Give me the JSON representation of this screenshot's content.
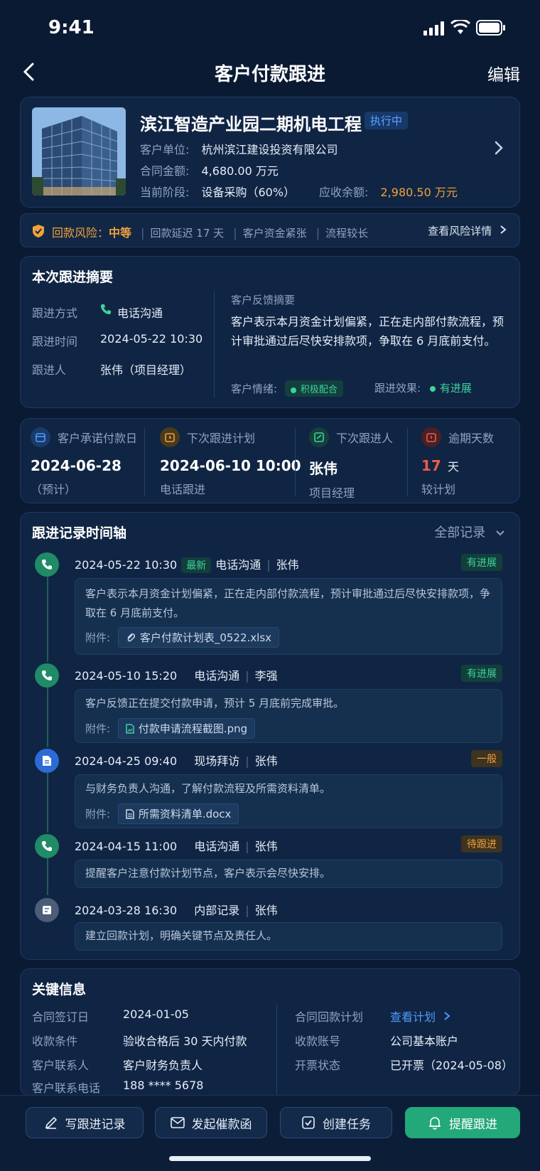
{
  "status_bar": {
    "time": "9:41"
  },
  "nav": {
    "title": "客户付款跟进",
    "edit": "编辑"
  },
  "project": {
    "name": "滨江智造产业园二期机电工程",
    "status": "执行中",
    "client_label": "客户单位:",
    "client": "杭州滨江建设投资有限公司",
    "amount_label": "合同金额:",
    "amount": "4,680.00 万元",
    "stage_label": "当前阶段:",
    "stage": "设备采购（60%）",
    "receivable_label": "应收余额:",
    "receivable": "2,980.50 万元"
  },
  "risk": {
    "label": "回款风险：",
    "level": "中等",
    "items": [
      "回款延迟 17 天",
      "客户资金紧张",
      "流程较长"
    ],
    "detail_link": "查看风险详情"
  },
  "summary": {
    "title": "本次跟进摘要",
    "method_label": "跟进方式",
    "method": "电话沟通",
    "time_label": "跟进时间",
    "time": "2024-05-22 10:30",
    "person_label": "跟进人",
    "person": "张伟（项目经理）",
    "feedback_label": "客户反馈摘要",
    "feedback": "客户表示本月资金计划偏紧，正在走内部付款流程，预计审批通过后尽快安排款项，争取在 6 月底前支付。",
    "mood_label": "客户情绪:",
    "mood": "积极配合",
    "effect_label": "跟进效果:",
    "effect": "有进展"
  },
  "stats": [
    {
      "label": "客户承诺付款日",
      "value": "2024-06-28",
      "sub": "（预计）",
      "icon": "calendar-icon",
      "color": "#4e9bff"
    },
    {
      "label": "下次跟进计划",
      "value": "2024-06-10 10:00",
      "sub": "电话跟进",
      "icon": "clock-icon",
      "color": "#f0a13a"
    },
    {
      "label": "下次跟进人",
      "value": "张伟",
      "sub": "项目经理",
      "icon": "person-icon",
      "color": "#3fd39a"
    },
    {
      "label": "逾期天数",
      "value": "17",
      "unit": "天",
      "sub": "较计划",
      "icon": "alarm-icon",
      "color": "#f05a4a"
    }
  ],
  "timeline": {
    "title": "跟进记录时间轴",
    "filter": "全部记录",
    "attach_label": "附件:",
    "records": [
      {
        "datetime": "2024-05-22 10:30",
        "latest": "最新",
        "type": "电话沟通",
        "person": "张伟",
        "status": "有进展",
        "text": "客户表示本月资金计划偏紧，正在走内部付款流程，预计审批通过后尽快安排款项，争取在 6 月底前支付。",
        "attachment": "客户付款计划表_0522.xlsx"
      },
      {
        "datetime": "2024-05-10 15:20",
        "type": "电话沟通",
        "person": "李强",
        "status": "有进展",
        "text": "客户反馈正在提交付款申请，预计 5 月底前完成审批。",
        "attachment": "付款申请流程截图.png"
      },
      {
        "datetime": "2024-04-25 09:40",
        "type": "现场拜访",
        "person": "张伟",
        "status": "一般",
        "text": "与财务负责人沟通，了解付款流程及所需资料清单。",
        "attachment": "所需资料清单.docx"
      },
      {
        "datetime": "2024-04-15 11:00",
        "type": "电话沟通",
        "person": "张伟",
        "status": "待跟进",
        "text": "提醒客户注意付款计划节点，客户表示会尽快安排。"
      },
      {
        "datetime": "2024-03-28 16:30",
        "type": "内部记录",
        "person": "张伟",
        "text": "建立回款计划，明确关键节点及责任人。"
      }
    ]
  },
  "key_info": {
    "title": "关键信息",
    "left": [
      {
        "label": "合同签订日",
        "value": "2024-01-05"
      },
      {
        "label": "收款条件",
        "value": "验收合格后 30 天内付款"
      },
      {
        "label": "客户联系人",
        "value": "客户财务负责人"
      },
      {
        "label": "客户联系电话",
        "value": "188 **** 5678"
      }
    ],
    "right": [
      {
        "label": "合同回款计划",
        "value": "查看计划"
      },
      {
        "label": "收款账号",
        "value": "公司基本账户"
      },
      {
        "label": "开票状态",
        "value": "已开票（2024-05-08）"
      }
    ]
  },
  "actions": {
    "write": "写跟进记录",
    "dun": "发起催款函",
    "task": "创建任务",
    "remind": "提醒跟进"
  }
}
